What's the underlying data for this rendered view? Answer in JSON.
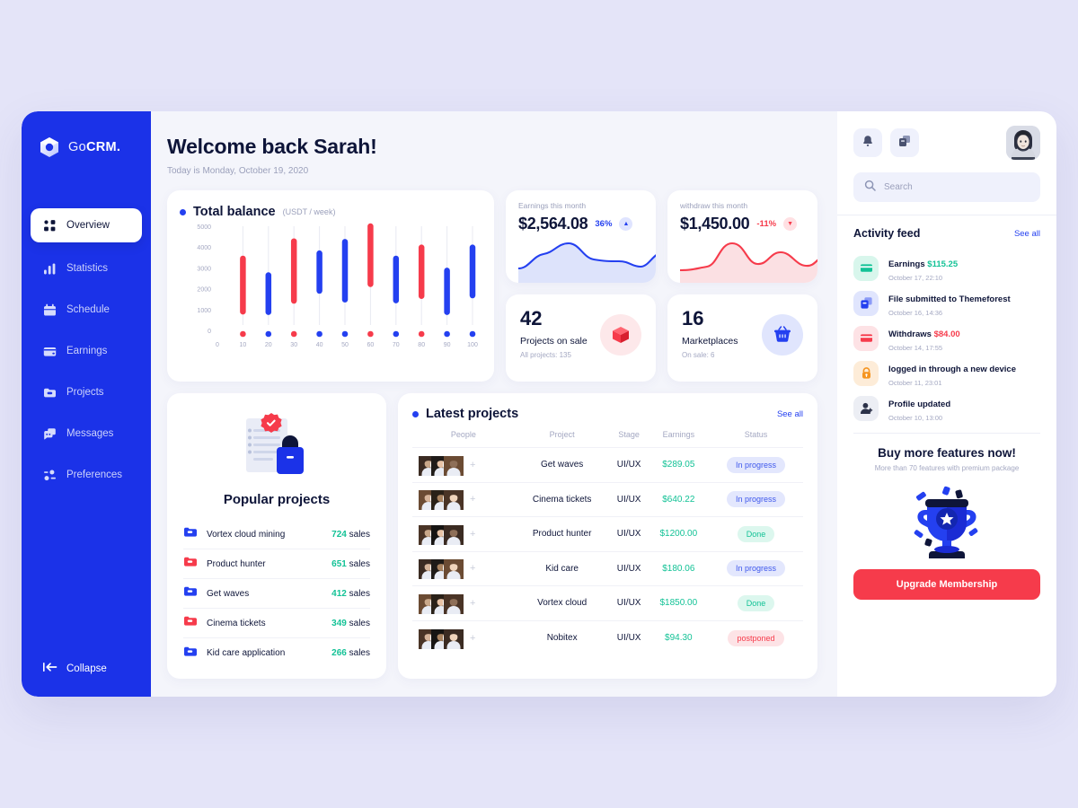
{
  "brand": {
    "go": "Go",
    "crm": "CRM."
  },
  "sidebar": {
    "items": [
      {
        "label": "Overview",
        "icon": "grid-icon"
      },
      {
        "label": "Statistics",
        "icon": "bar-chart-icon"
      },
      {
        "label": "Schedule",
        "icon": "calendar-icon"
      },
      {
        "label": "Earnings",
        "icon": "card-icon"
      },
      {
        "label": "Projects",
        "icon": "folder-icon"
      },
      {
        "label": "Messages",
        "icon": "chat-icon"
      },
      {
        "label": "Preferences",
        "icon": "sliders-icon"
      }
    ],
    "collapse_label": "Collapse"
  },
  "header": {
    "title": "Welcome back Sarah!",
    "subtitle": "Today is Monday, October 19, 2020"
  },
  "balance": {
    "title": "Total balance",
    "unit": "(USDT / week)"
  },
  "chart_data": {
    "type": "bar",
    "title": "Total balance",
    "subtitle": "(USDT / week)",
    "xlabel": "",
    "ylabel": "",
    "x": [
      0,
      10,
      20,
      30,
      40,
      50,
      60,
      70,
      80,
      90,
      100
    ],
    "xticks": [
      "0",
      "10",
      "20",
      "30",
      "40",
      "50",
      "60",
      "70",
      "80",
      "90",
      "100"
    ],
    "yticks": [
      "0",
      "1000",
      "2000",
      "3000",
      "4000",
      "5000"
    ],
    "ylim": [
      0,
      5000
    ],
    "grid": false,
    "legend": "Total balance",
    "series": [
      {
        "name": "candles",
        "items": [
          {
            "x": 10,
            "low": 900,
            "high": 3450,
            "color": "#f63b4b"
          },
          {
            "x": 20,
            "low": 880,
            "high": 2650,
            "color": "#2440f0"
          },
          {
            "x": 30,
            "low": 1420,
            "high": 4280,
            "color": "#f63b4b"
          },
          {
            "x": 40,
            "low": 1900,
            "high": 3700,
            "color": "#2440f0"
          },
          {
            "x": 50,
            "low": 1480,
            "high": 4250,
            "color": "#2440f0"
          },
          {
            "x": 60,
            "low": 2220,
            "high": 5000,
            "color": "#f63b4b"
          },
          {
            "x": 70,
            "low": 1440,
            "high": 3450,
            "color": "#2440f0"
          },
          {
            "x": 80,
            "low": 1650,
            "high": 3980,
            "color": "#f63b4b"
          },
          {
            "x": 90,
            "low": 880,
            "high": 2870,
            "color": "#2440f0"
          },
          {
            "x": 100,
            "low": 1680,
            "high": 3980,
            "color": "#2440f0"
          }
        ]
      }
    ]
  },
  "stats": {
    "earnings": {
      "label": "Earnings this month",
      "value": "$2,564.08",
      "change": "36%",
      "direction": "up",
      "arrow": "▲",
      "color": "#2440f0"
    },
    "withdraw": {
      "label": "withdraw this month",
      "value": "$1,450.00",
      "change": "-11%",
      "direction": "down",
      "arrow": "▼",
      "color": "#f63b4b"
    },
    "projects": {
      "number": "42",
      "label": "Projects on sale",
      "sub": "All projects: 135",
      "icon": "box-icon",
      "color": "#f63b4b"
    },
    "marketplaces": {
      "number": "16",
      "label": "Marketplaces",
      "sub": "On sale: 6",
      "icon": "basket-icon",
      "color": "#2440f0"
    }
  },
  "popular": {
    "title": "Popular projects",
    "unit": "sales",
    "items": [
      {
        "name": "Vortex cloud mining",
        "count": "724",
        "icon_color": "#2440f0"
      },
      {
        "name": "Product hunter",
        "count": "651",
        "icon_color": "#f63b4b"
      },
      {
        "name": "Get waves",
        "count": "412",
        "icon_color": "#2440f0"
      },
      {
        "name": "Cinema tickets",
        "count": "349",
        "icon_color": "#f63b4b"
      },
      {
        "name": "Kid care application",
        "count": "266",
        "icon_color": "#2440f0"
      }
    ]
  },
  "latest": {
    "title": "Latest projects",
    "see_all": "See all",
    "columns": [
      "People",
      "Project",
      "Stage",
      "Earnings",
      "Status"
    ],
    "rows": [
      {
        "project": "Get waves",
        "stage": "UI/UX",
        "earnings": "$289.05",
        "status": "In progress",
        "status_type": "prog"
      },
      {
        "project": "Cinema tickets",
        "stage": "UI/UX",
        "earnings": "$640.22",
        "status": "In progress",
        "status_type": "prog"
      },
      {
        "project": "Product hunter",
        "stage": "UI/UX",
        "earnings": "$1200.00",
        "status": "Done",
        "status_type": "done"
      },
      {
        "project": "Kid care",
        "stage": "UI/UX",
        "earnings": "$180.06",
        "status": "In progress",
        "status_type": "prog"
      },
      {
        "project": "Vortex cloud",
        "stage": "UI/UX",
        "earnings": "$1850.00",
        "status": "Done",
        "status_type": "done"
      },
      {
        "project": "Nobitex",
        "stage": "UI/UX",
        "earnings": "$94.30",
        "status": "postponed",
        "status_type": "post"
      }
    ]
  },
  "rightpanel": {
    "bell_icon": "bell-icon",
    "copy_icon": "copy-icon",
    "avatar": "user-avatar",
    "search": {
      "placeholder": "Search",
      "value": "",
      "icon": "search-icon"
    },
    "activity": {
      "title": "Activity feed",
      "see_all": "See all",
      "items": [
        {
          "text": "Earnings ",
          "amount": "$115.25",
          "amount_class": "green",
          "date": "October 17, 22:10",
          "icon": "credit-card-icon",
          "bg": "#d8f6ec",
          "fg": "#13c296"
        },
        {
          "text": "File submitted to Themeforest",
          "amount": "",
          "amount_class": "",
          "date": "October 16, 14:36",
          "icon": "files-icon",
          "bg": "#e0e5fd",
          "fg": "#2440f0"
        },
        {
          "text": "Withdraws ",
          "amount": "$84.00",
          "amount_class": "red",
          "date": "October 14, 17:55",
          "icon": "credit-card-icon",
          "bg": "#fde2e5",
          "fg": "#f63b4b"
        },
        {
          "text": "logged in through a new device",
          "amount": "",
          "amount_class": "",
          "date": "October 11, 23:01",
          "icon": "lock-icon",
          "bg": "#fdecd8",
          "fg": "#f5941f"
        },
        {
          "text": "Profile updated",
          "amount": "",
          "amount_class": "",
          "date": "October 10, 13:00",
          "icon": "user-plus-icon",
          "bg": "#eceef4",
          "fg": "#2b3148"
        }
      ]
    },
    "promo": {
      "heading": "Buy more features now!",
      "sub": "More than 70 features with premium package",
      "art": "trophy-icon",
      "button": "Upgrade Membership"
    }
  }
}
